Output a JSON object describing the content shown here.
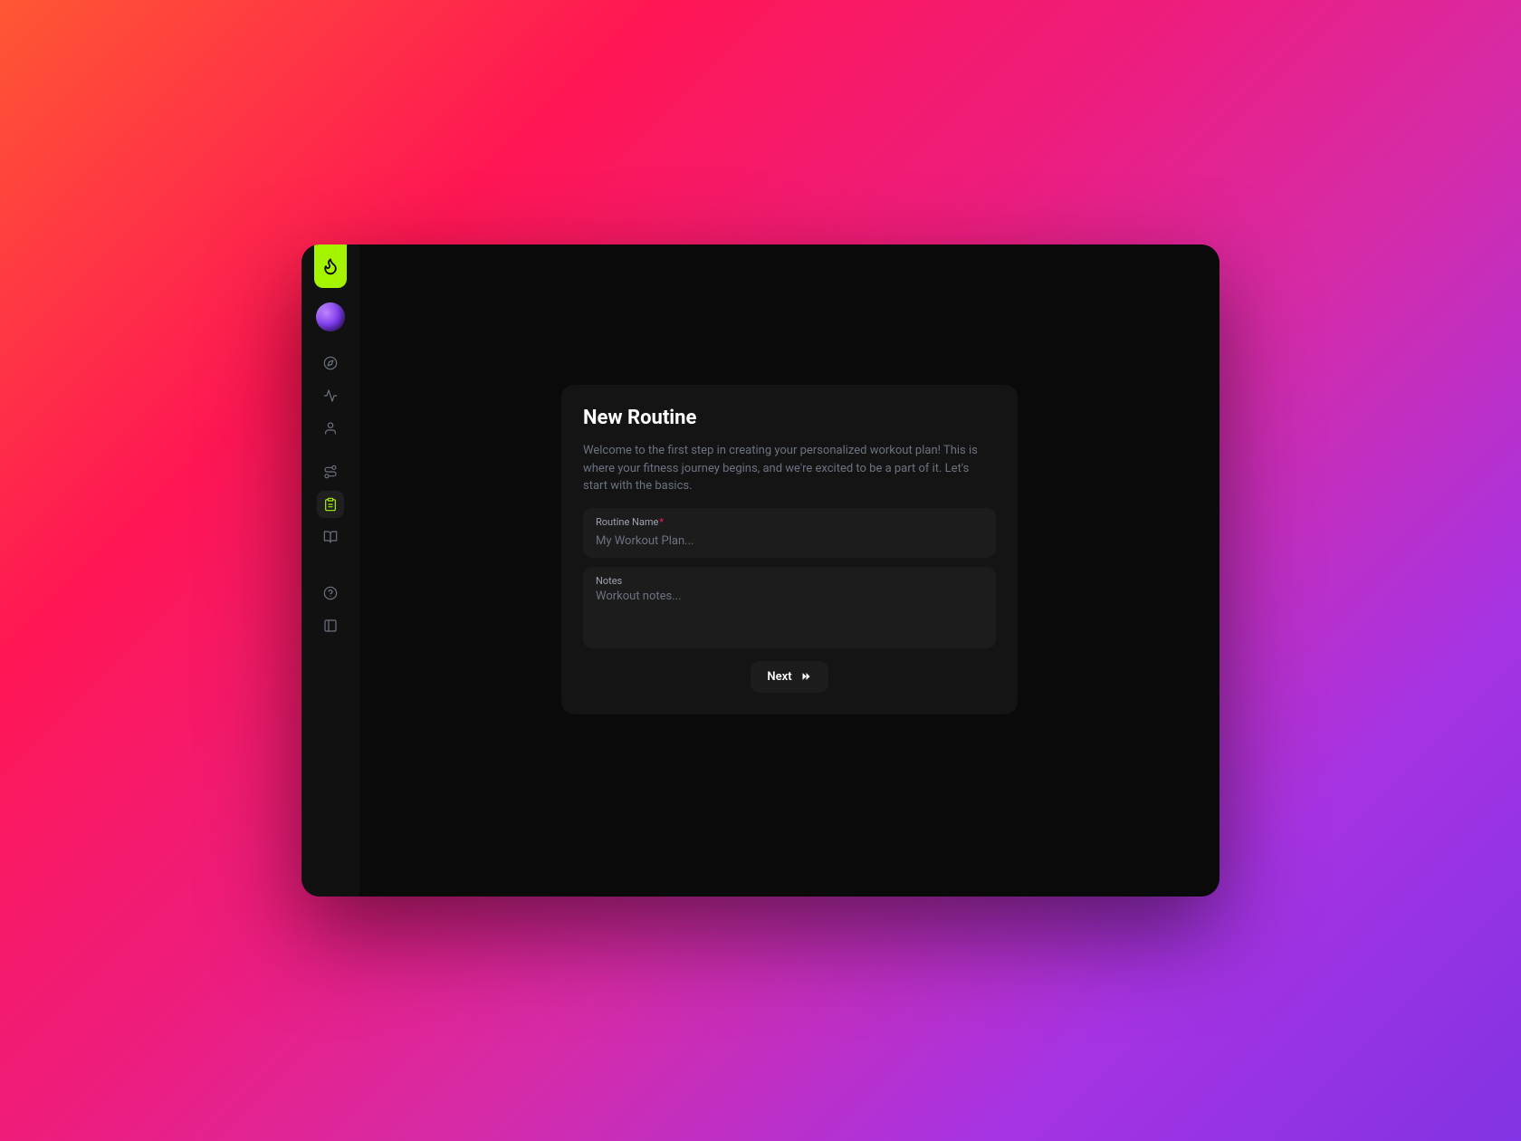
{
  "colors": {
    "accent": "#a4f400",
    "danger": "#ff1654"
  },
  "sidebar": {
    "logo_icon": "flame-icon",
    "avatar": "user-avatar",
    "items": [
      {
        "icon": "compass-icon"
      },
      {
        "icon": "activity-icon"
      },
      {
        "icon": "user-icon"
      },
      {
        "icon": "route-icon"
      },
      {
        "icon": "clipboard-icon",
        "active": true
      },
      {
        "icon": "book-icon"
      }
    ],
    "bottom_items": [
      {
        "icon": "help-icon"
      },
      {
        "icon": "sidebar-toggle-icon"
      }
    ]
  },
  "card": {
    "title": "New Routine",
    "description": "Welcome to the first step in creating your personalized workout plan! This is where your fitness journey begins, and we're excited to be a part of it. Let's start with the basics.",
    "fields": {
      "name": {
        "label": "Routine Name",
        "required": "*",
        "placeholder": "My Workout Plan...",
        "value": ""
      },
      "notes": {
        "label": "Notes",
        "placeholder": "Workout notes...",
        "value": ""
      }
    },
    "next_button": "Next"
  }
}
